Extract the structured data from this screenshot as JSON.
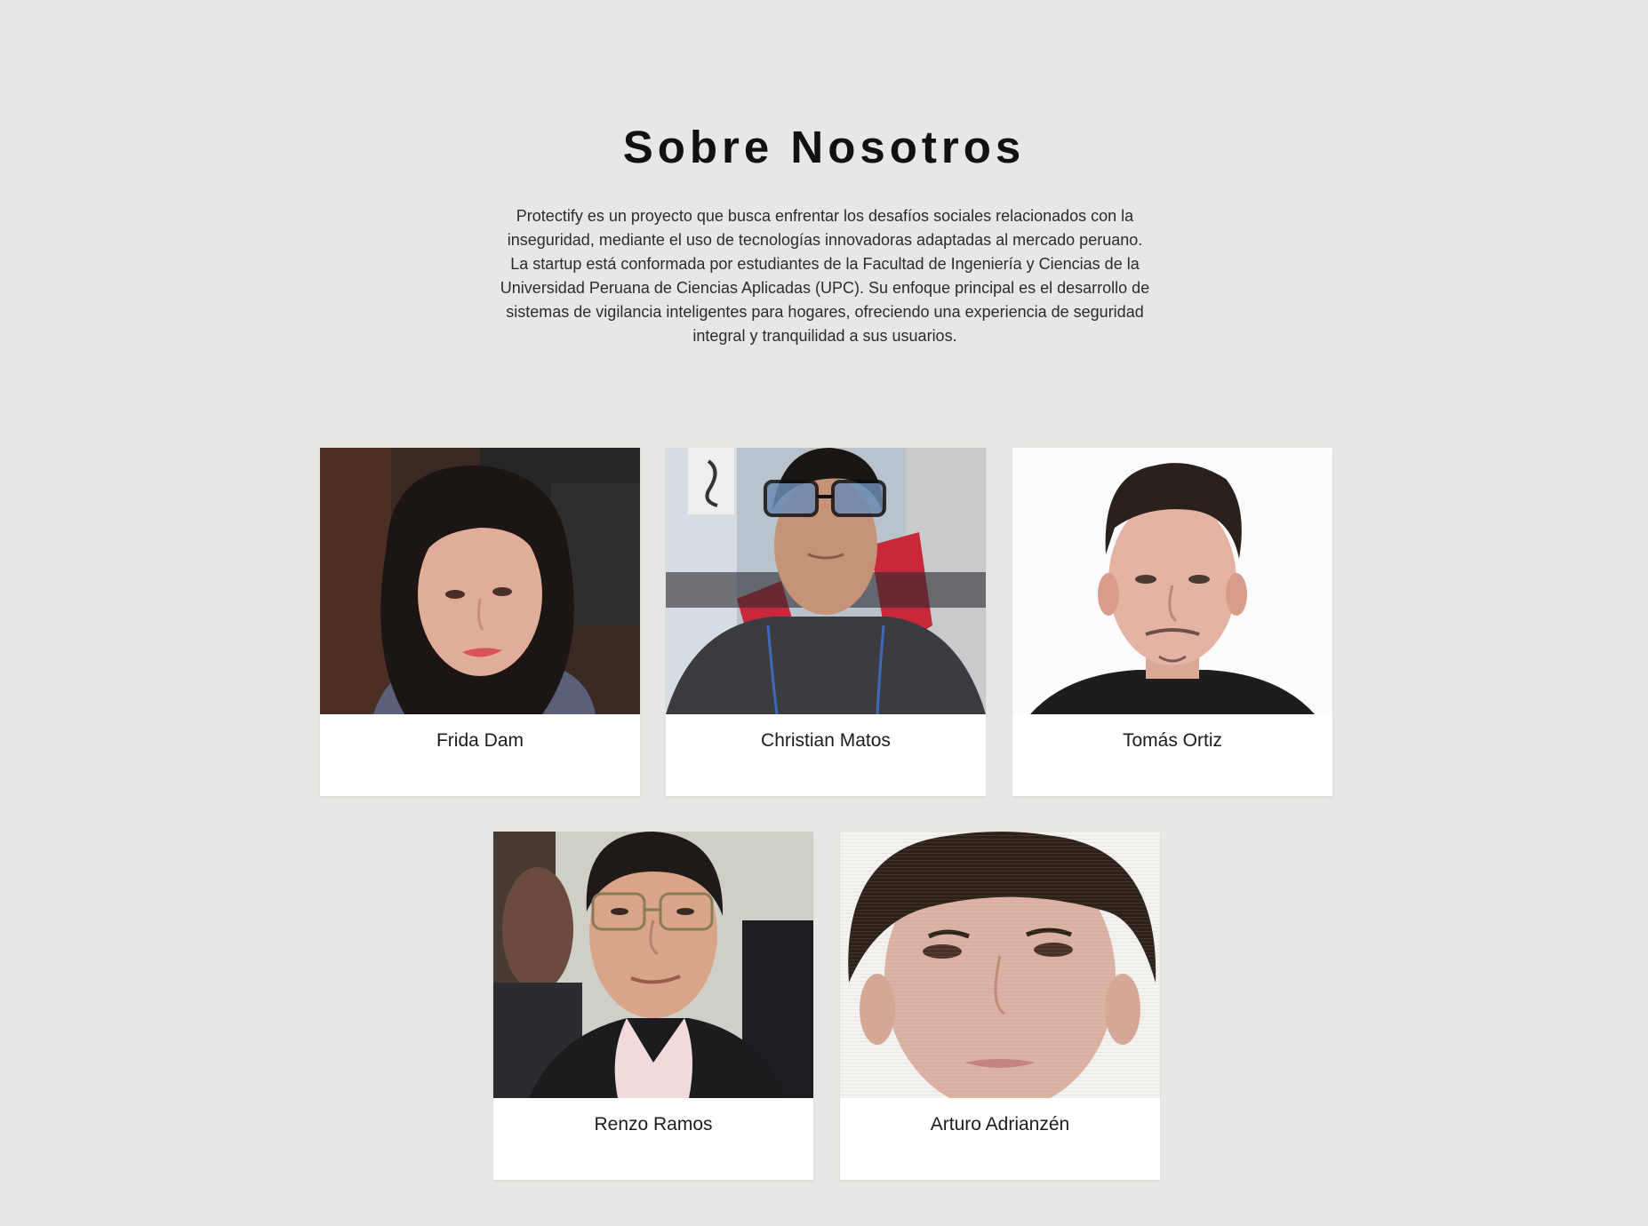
{
  "about": {
    "title": "Sobre Nosotros",
    "description": "Protectify es un proyecto que busca enfrentar los desafíos sociales relacionados con la inseguridad, mediante el uso de tecnologías innovadoras adaptadas al mercado peruano. La startup está conformada por estudiantes de la Facultad de Ingeniería y Ciencias de la Universidad Peruana de Ciencias Aplicadas (UPC). Su enfoque principal es el desarrollo de sistemas de vigilancia inteligentes para hogares, ofreciendo una experiencia de seguridad integral y tranquilidad a sus usuarios."
  },
  "team": [
    {
      "name": "Frida Dam"
    },
    {
      "name": "Christian Matos"
    },
    {
      "name": "Tomás Ortiz"
    },
    {
      "name": "Renzo Ramos"
    },
    {
      "name": "Arturo Adrianzén"
    }
  ],
  "colors": {
    "background": "#e7e8e5",
    "card": "#ffffff",
    "title": "#111111"
  }
}
